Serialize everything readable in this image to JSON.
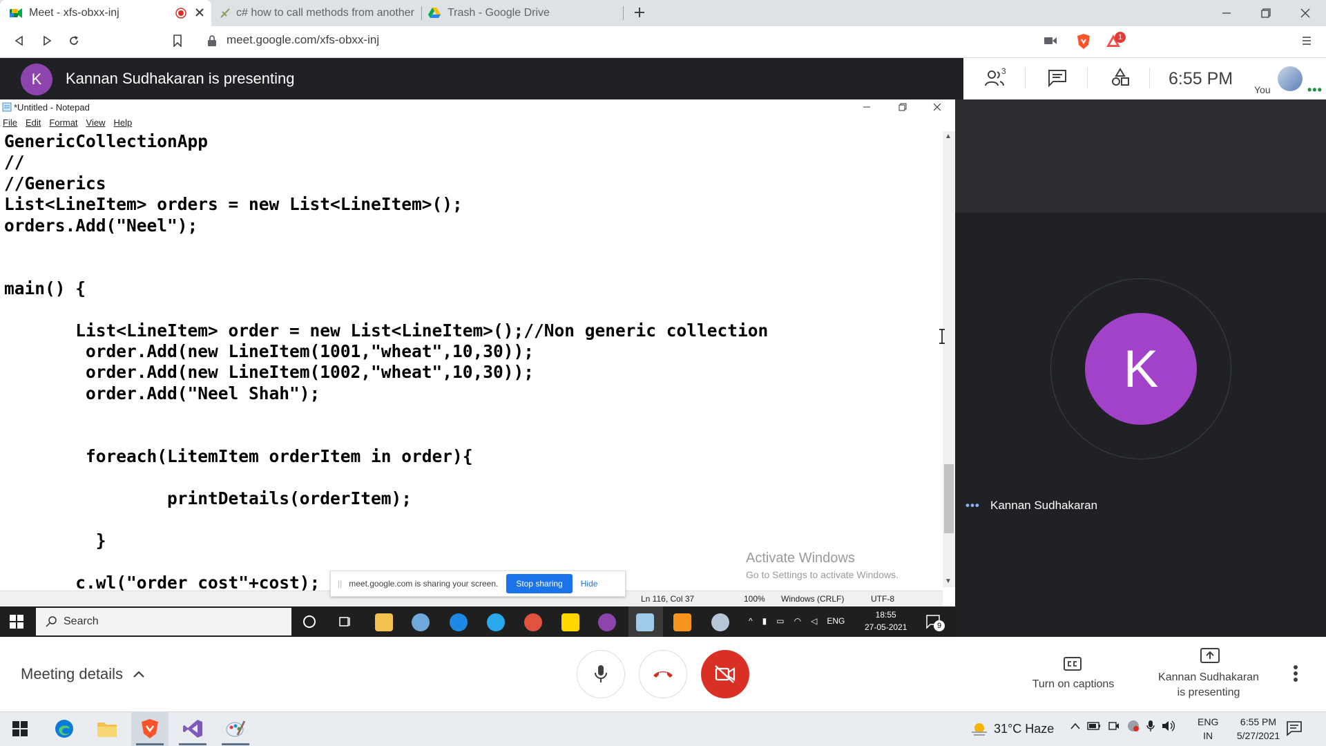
{
  "browser": {
    "tabs": [
      {
        "title": "Meet - xfs-obxx-inj",
        "active": true,
        "icon": "google-meet-icon"
      },
      {
        "title": "c# how to call methods from another",
        "active": false,
        "icon": "stackoverflow-icon"
      },
      {
        "title": "Trash - Google Drive",
        "active": false,
        "icon": "google-drive-icon"
      }
    ],
    "url": "meet.google.com/xfs-obxx-inj",
    "brave_badge": "1"
  },
  "meet": {
    "presenting_banner": "Kannan Sudhakaran is presenting",
    "presenter_initial": "K",
    "participants_count": "3",
    "clock": "6:55 PM",
    "you_label": "You",
    "participant_name": "Kannan Sudhakaran",
    "participant_initial": "K",
    "meeting_details": "Meeting details",
    "captions_label": "Turn on captions",
    "presenting_label_1": "Kannan Sudhakaran",
    "presenting_label_2": "is presenting",
    "accent": "#1a73e8",
    "danger": "#d93025",
    "avatar_color": "#a142c9"
  },
  "notepad": {
    "title": "*Untitled - Notepad",
    "menu": [
      "File",
      "Edit",
      "Format",
      "View",
      "Help"
    ],
    "code_lines": [
      "GenericCollectionApp",
      "//",
      "//Generics",
      "List<LineItem> orders = new List<LineItem>();",
      "orders.Add(\"Neel\");",
      "",
      "",
      "main() {",
      "",
      "       List<LineItem> order = new List<LineItem>();//Non generic collection",
      "        order.Add(new LineItem(1001,\"wheat\",10,30));",
      "        order.Add(new LineItem(1002,\"wheat\",10,30));",
      "        order.Add(\"Neel Shah\");",
      "",
      "",
      "        foreach(LitemItem orderItem in order){",
      "",
      "                printDetails(orderItem);",
      "",
      "         }",
      "",
      "       c.wl(\"order cost\"+cost);"
    ],
    "status": {
      "position": "Ln 116, Col 37",
      "zoom": "100%",
      "line_ending": "Windows (CRLF)",
      "encoding": "UTF-8"
    },
    "activate_windows_1": "Activate Windows",
    "activate_windows_2": "Go to Settings to activate Windows."
  },
  "share_banner": {
    "text": "meet.google.com is sharing your screen.",
    "stop_label": "Stop sharing",
    "hide_label": "Hide"
  },
  "remote_taskbar": {
    "search_placeholder": "Search",
    "lang": "ENG",
    "time": "18:55",
    "date": "27-05-2021",
    "notif_count": "9"
  },
  "local_taskbar": {
    "weather": "31°C  Haze",
    "lang_1": "ENG",
    "lang_2": "IN",
    "time": "6:55 PM",
    "date": "5/27/2021"
  }
}
